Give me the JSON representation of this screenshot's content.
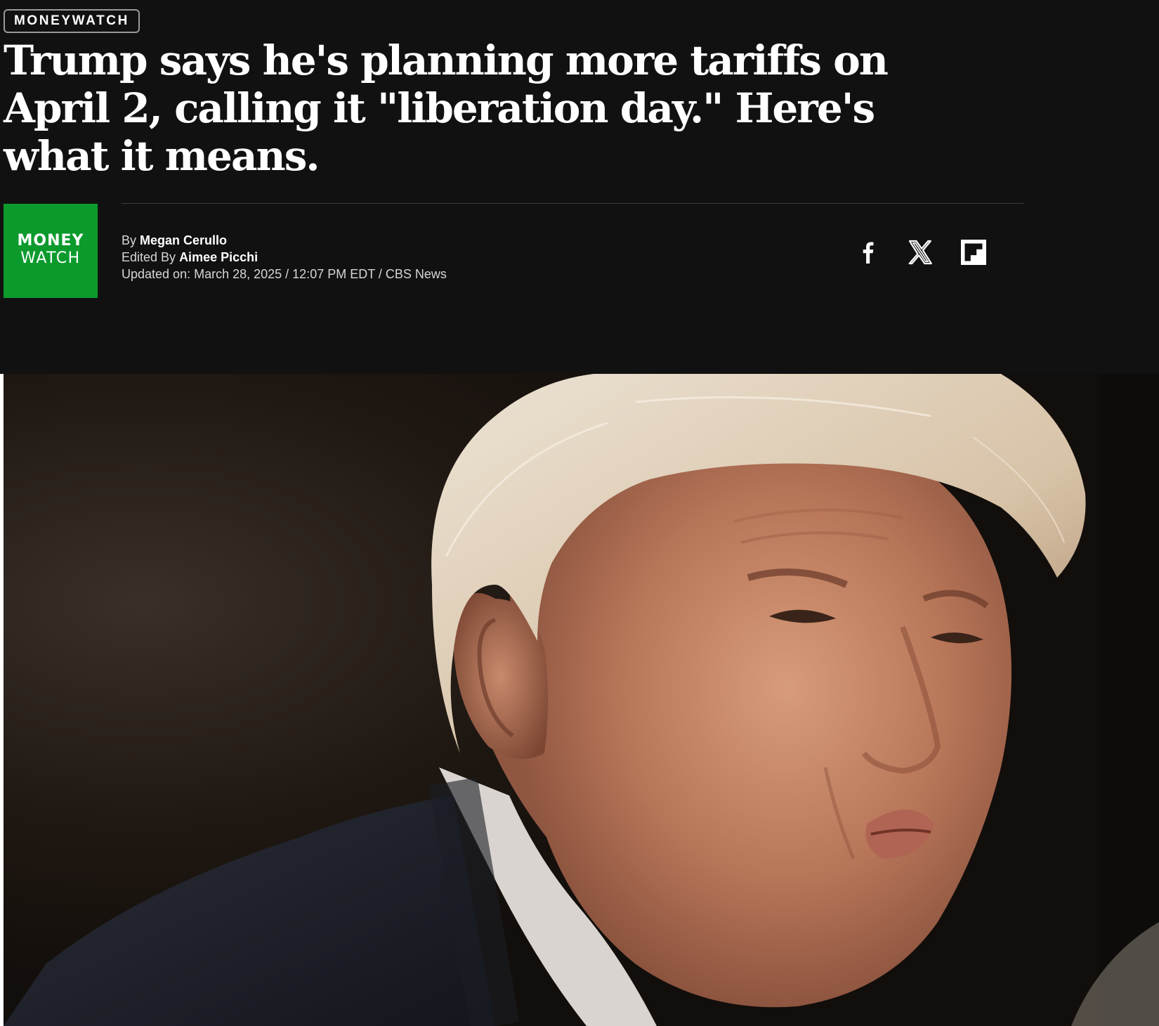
{
  "section": {
    "label": "MONEYWATCH"
  },
  "headline": "Trump says he's planning more tariffs on April 2, calling it \"liberation day.\" Here's what it means.",
  "brand_logo": {
    "line1": "MONEY",
    "line2": "WATCH",
    "color": "#0c9a2d"
  },
  "byline": {
    "by_prefix": "By",
    "author": "Megan Cerullo",
    "edited_prefix": "Edited By",
    "editor": "Aimee Picchi",
    "updated_prefix": "Updated on:",
    "updated": "March 28, 2025 / 12:07 PM EDT / CBS News"
  },
  "share": {
    "icons": [
      "facebook-icon",
      "x-icon",
      "flipboard-icon"
    ]
  },
  "colors": {
    "background": "#111111",
    "text": "#ffffff",
    "accent": "#0c9a2d"
  }
}
